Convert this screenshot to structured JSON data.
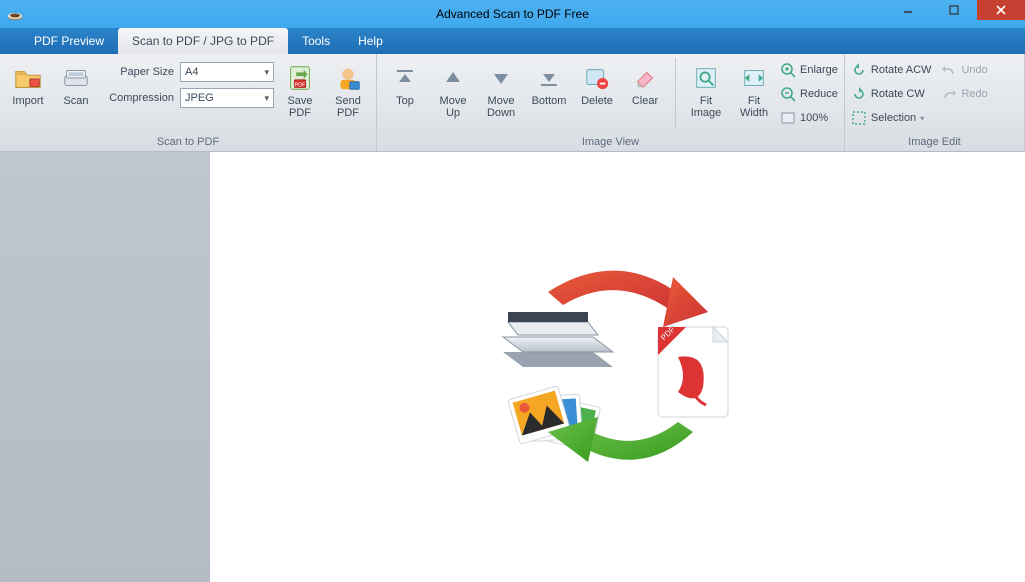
{
  "window": {
    "title": "Advanced Scan to PDF Free"
  },
  "tabs": {
    "pdf_preview": "PDF Preview",
    "scan_to_pdf": "Scan to PDF / JPG to PDF",
    "tools": "Tools",
    "help": "Help"
  },
  "ribbon": {
    "scan_group": {
      "caption": "Scan to PDF",
      "import": "Import",
      "scan": "Scan",
      "paper_size_label": "Paper Size",
      "paper_size_value": "A4",
      "compression_label": "Compression",
      "compression_value": "JPEG",
      "save_pdf": "Save\nPDF",
      "send_pdf": "Send\nPDF"
    },
    "image_view": {
      "caption": "Image View",
      "top": "Top",
      "move_up": "Move\nUp",
      "move_down": "Move\nDown",
      "bottom": "Bottom",
      "delete": "Delete",
      "clear": "Clear",
      "fit_image": "Fit\nImage",
      "fit_width": "Fit\nWidth",
      "enlarge": "Enlarge",
      "reduce": "Reduce",
      "zoom100": "100%"
    },
    "image_edit": {
      "caption": "Image Edit",
      "rotate_acw": "Rotate ACW",
      "rotate_cw": "Rotate CW",
      "selection": "Selection",
      "undo": "Undo",
      "redo": "Redo"
    }
  }
}
